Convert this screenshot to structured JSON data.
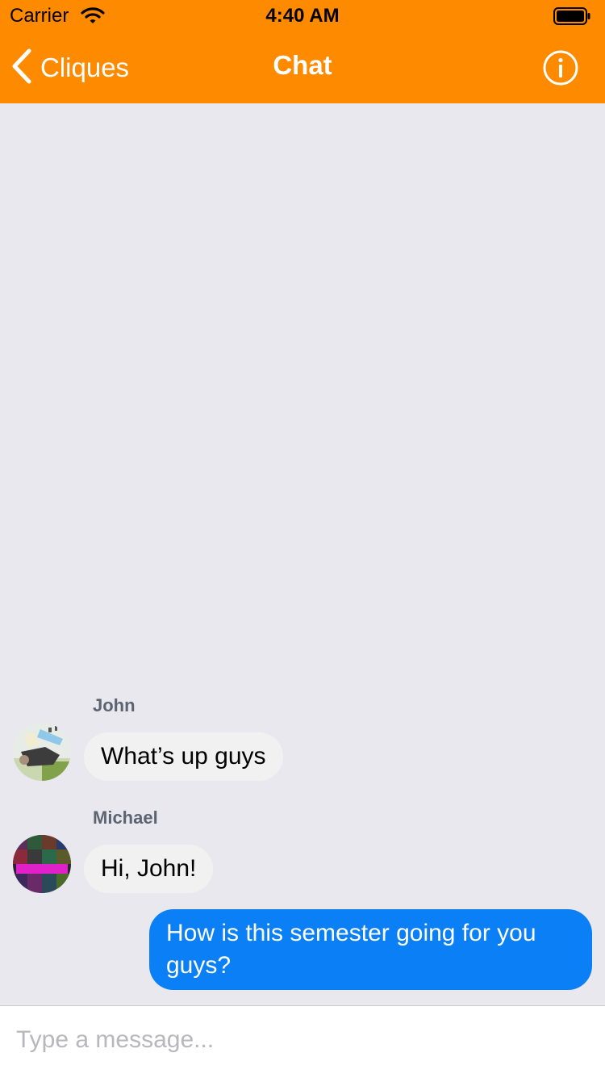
{
  "status_bar": {
    "carrier": "Carrier",
    "time": "4:40 AM",
    "wifi_icon": "wifi-icon",
    "battery_icon": "battery-icon"
  },
  "nav": {
    "back_label": "Cliques",
    "title": "Chat",
    "back_icon": "chevron-left-icon",
    "info_icon": "info-icon",
    "bar_color": "#fe8a00"
  },
  "messages": [
    {
      "sender": "John",
      "text": "What’s up guys",
      "direction": "incoming"
    },
    {
      "sender": "Michael",
      "text": "Hi, John!",
      "direction": "incoming"
    },
    {
      "text": "How is this semester going for you guys?",
      "direction": "outgoing"
    }
  ],
  "composer": {
    "placeholder": "Type a message...",
    "value": ""
  },
  "colors": {
    "background": "#e9e8ee",
    "incoming_bubble": "#f1f1f1",
    "outgoing_bubble": "#0a7ff6"
  }
}
